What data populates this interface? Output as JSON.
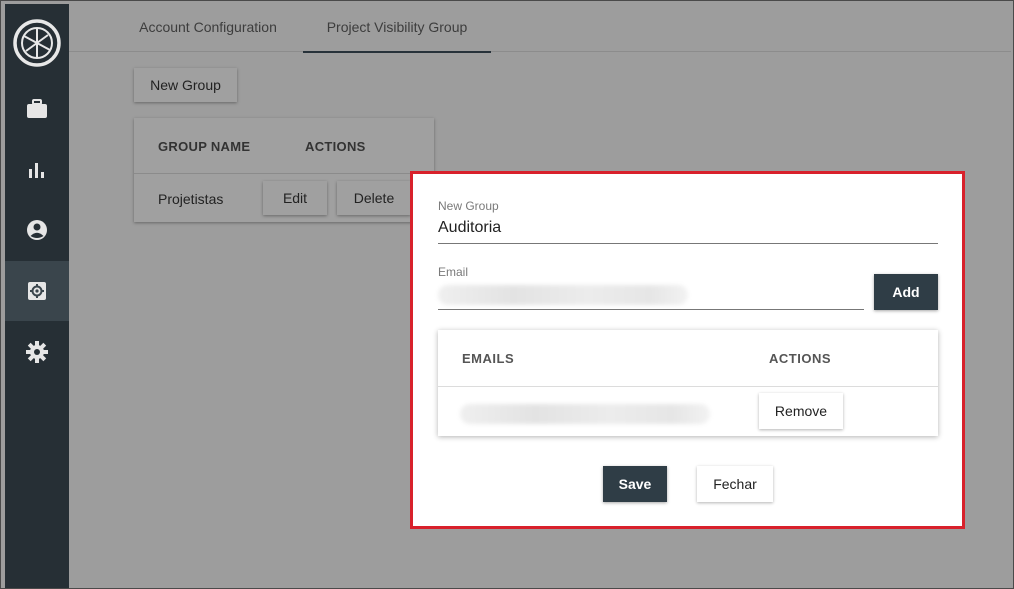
{
  "tabs": [
    {
      "label": "Account Configuration",
      "active": false
    },
    {
      "label": "Project Visibility Group",
      "active": true
    }
  ],
  "sidebar": {
    "items": [
      {
        "icon": "briefcase-icon",
        "active": false
      },
      {
        "icon": "bar-chart-icon",
        "active": false
      },
      {
        "icon": "account-circle-icon",
        "active": false
      },
      {
        "icon": "admin-settings-icon",
        "active": true
      },
      {
        "icon": "gear-icon",
        "active": false
      }
    ]
  },
  "background": {
    "new_group_label": "New Group",
    "table": {
      "headers": [
        "GROUP NAME",
        "ACTIONS"
      ],
      "rows": [
        {
          "name": "Projetistas",
          "edit_label": "Edit",
          "delete_label": "Delete"
        }
      ]
    }
  },
  "modal": {
    "group_field": {
      "label": "New Group",
      "value": "Auditoria"
    },
    "email_field": {
      "label": "Email",
      "value": ""
    },
    "add_label": "Add",
    "emails_table": {
      "headers": [
        "EMAILS",
        "ACTIONS"
      ],
      "rows": [
        {
          "email": "",
          "remove_label": "Remove"
        }
      ]
    },
    "save_label": "Save",
    "close_label": "Fechar"
  },
  "colors": {
    "sidebar_bg": "#262f35",
    "primary_button": "#2f3d46",
    "highlight_border": "#d8212b"
  }
}
